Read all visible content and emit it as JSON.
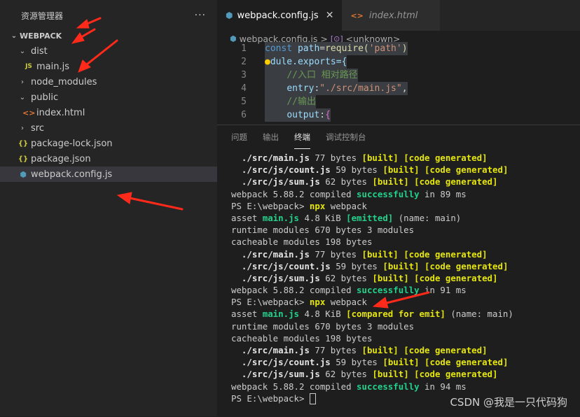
{
  "sidebar": {
    "title": "资源管理器",
    "more": "···",
    "tree": [
      {
        "label": "WEBPACK",
        "chevron": "⌄",
        "icon": ""
      },
      {
        "label": "dist",
        "chevron": "⌄",
        "icon": ""
      },
      {
        "label": "main.js",
        "chevron": "",
        "icon": "JS"
      },
      {
        "label": "node_modules",
        "chevron": "›",
        "icon": ""
      },
      {
        "label": "public",
        "chevron": "⌄",
        "icon": ""
      },
      {
        "label": "index.html",
        "chevron": "",
        "icon": "<>"
      },
      {
        "label": "src",
        "chevron": "›",
        "icon": ""
      },
      {
        "label": "package-lock.json",
        "chevron": "",
        "icon": "{}"
      },
      {
        "label": "package.json",
        "chevron": "",
        "icon": "{}"
      },
      {
        "label": "webpack.config.js",
        "chevron": "",
        "icon": "⬢"
      }
    ]
  },
  "tabs": [
    {
      "label": "webpack.config.js",
      "close": "✕"
    },
    {
      "label": "index.html"
    }
  ],
  "breadcrumb": {
    "file": "webpack.config.js",
    "sep": ">",
    "symbol": "<unknown>"
  },
  "code": [
    {
      "n": "1",
      "a": "const ",
      "b": "path",
      "c": "=",
      "d": "require",
      "e": "(",
      "f": "'path'",
      "g": ")"
    },
    {
      "n": "2",
      "text": "dule.exports={"
    },
    {
      "n": "3",
      "text": "//入口 相对路径"
    },
    {
      "n": "4",
      "k": "entry",
      "p": ":",
      "s": "\"./src/main.js\"",
      "q": ","
    },
    {
      "n": "5",
      "text": "//输出"
    },
    {
      "n": "6",
      "k": "output",
      "p": ":",
      "s": "{",
      "q": ""
    }
  ],
  "panel_tabs": [
    "问题",
    "输出",
    "终端",
    "调试控制台"
  ],
  "terminal": {
    "built": "[built]",
    "codegen": "[code generated]",
    "l1": "./src/main.js",
    "l1b": " 77 bytes ",
    "l2": "./src/js/count.js",
    "l2b": " 59 bytes ",
    "l3": "./src/js/sum.js",
    "l3b": " 62 bytes ",
    "compiled_pre": "webpack 5.88.2 compiled ",
    "success": "successfully",
    "t89": " in 89 ms",
    "t91": " in 91 ms",
    "t94": " in 94 ms",
    "prompt": "PS E:\\webpack> ",
    "npx": "npx",
    "webpack_cmd": " webpack",
    "asset": "asset ",
    "mainjs": "main.js",
    "size": " 4.8 KiB ",
    "emitted": "[emitted]",
    "compared": "[compared for emit]",
    "name": " (name: main)",
    "runtime": "runtime modules 670 bytes 3 modules",
    "cacheable": "cacheable modules 198 bytes"
  },
  "watermark": "CSDN @我是一只代码狗",
  "colors": {
    "annotation_arrow": "#ff2a1a",
    "success": "#23d18b",
    "status_yellow": "#e5e510"
  }
}
